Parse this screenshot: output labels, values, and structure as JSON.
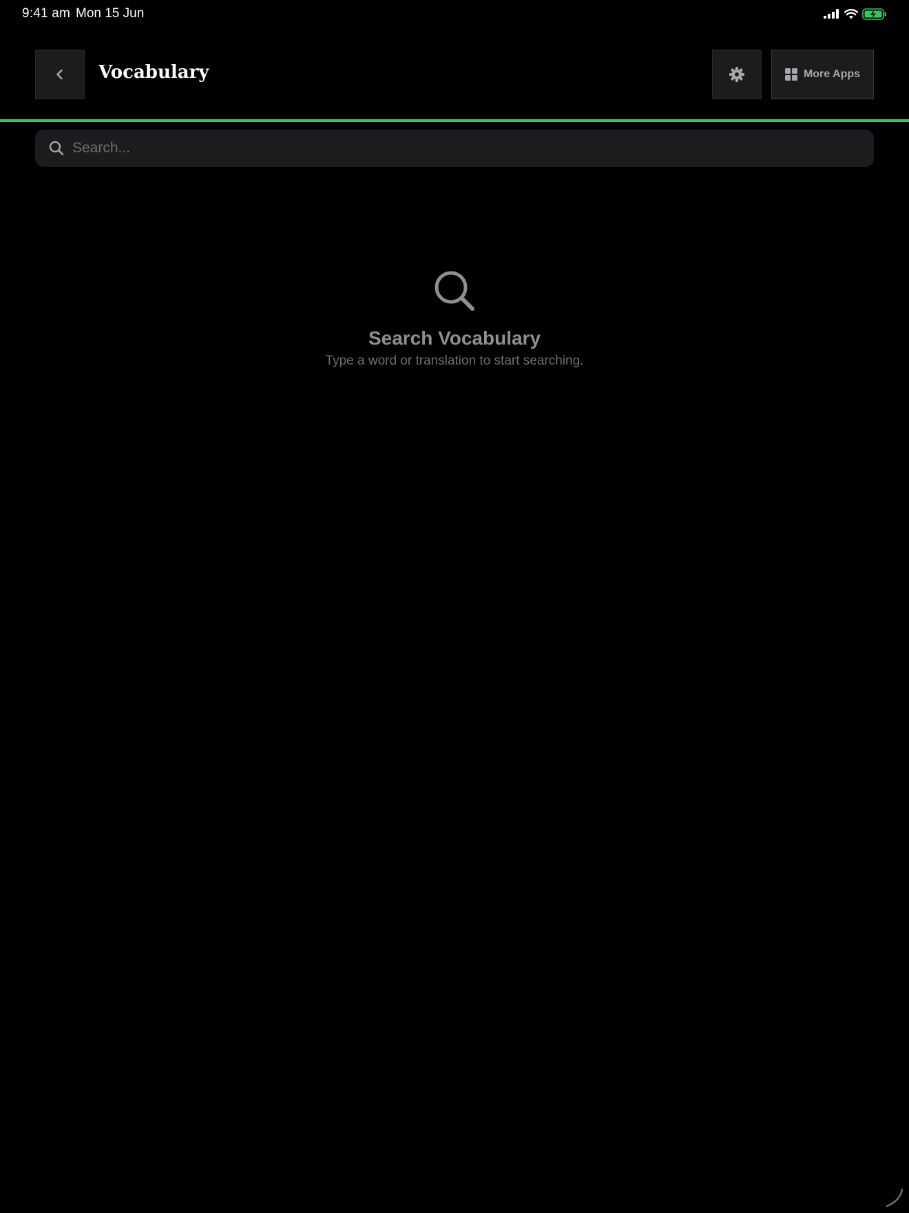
{
  "status_bar": {
    "time": "9:41 am",
    "date": "Mon 15 Jun",
    "battery_color": "#34c759"
  },
  "header": {
    "back_icon": "chevron-left-icon",
    "title": "Vocabulary",
    "settings_icon": "gear-icon",
    "more_apps_icon": "grid-icon",
    "more_apps_label": "More Apps",
    "accent_color": "#34c759"
  },
  "search": {
    "placeholder": "Search...",
    "value": ""
  },
  "empty_state": {
    "icon": "search-icon",
    "title": "Search Vocabulary",
    "subtitle": "Type a word or translation to start searching."
  }
}
